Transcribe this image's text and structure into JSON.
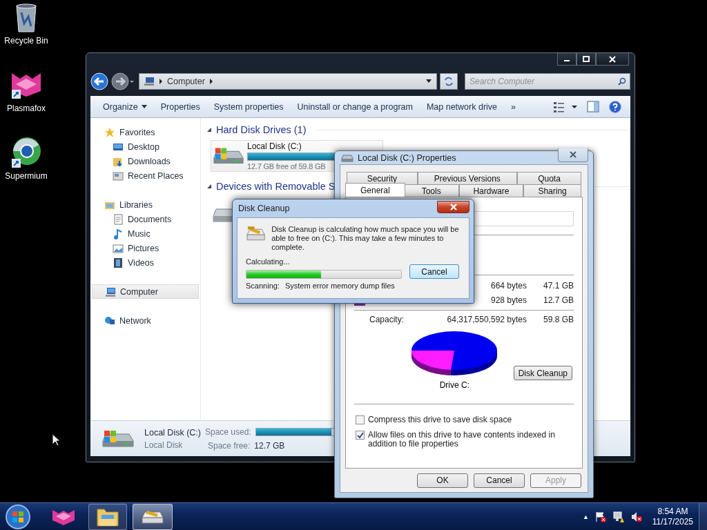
{
  "desktop_icons": [
    {
      "label": "Recycle Bin",
      "kind": "bin"
    },
    {
      "label": "Plasmafox",
      "kind": "plasmafox"
    },
    {
      "label": "Supermium",
      "kind": "supermium"
    }
  ],
  "explorer": {
    "address": "Computer",
    "search": {
      "placeholder": "Search Computer"
    },
    "toolbar": [
      {
        "label": "Organize",
        "dropdown": true
      },
      {
        "label": "Properties",
        "dropdown": false
      },
      {
        "label": "System properties",
        "dropdown": false
      },
      {
        "label": "Uninstall or change a program",
        "dropdown": false
      },
      {
        "label": "Map network drive",
        "dropdown": false
      }
    ],
    "toolbar_overflow": "»",
    "nav": [
      {
        "label": "Favorites",
        "kind": "star",
        "selected": false,
        "children": [
          {
            "label": "Desktop",
            "kind": "desktop",
            "selected": false
          },
          {
            "label": "Downloads",
            "kind": "downloads",
            "selected": false
          },
          {
            "label": "Recent Places",
            "kind": "recent",
            "selected": false
          }
        ]
      },
      {
        "label": "Libraries",
        "kind": "library",
        "selected": false,
        "children": [
          {
            "label": "Documents",
            "kind": "documents",
            "selected": false
          },
          {
            "label": "Music",
            "kind": "music",
            "selected": false
          },
          {
            "label": "Pictures",
            "kind": "pictures",
            "selected": false
          },
          {
            "label": "Videos",
            "kind": "videos",
            "selected": false
          }
        ]
      },
      {
        "label": "Computer",
        "kind": "computer",
        "selected": true
      },
      {
        "label": "Network",
        "kind": "network",
        "selected": false
      }
    ],
    "groups": [
      {
        "title": "Hard Disk Drives (1)",
        "drives": [
          {
            "kind": "disk",
            "name": "Local Disk (C:)",
            "level": 0.79,
            "free": "12.7 GB free of 59.8 GB"
          }
        ]
      },
      {
        "title": "Devices with Removable S",
        "drives": [
          {
            "kind": "removable"
          }
        ]
      }
    ],
    "details": {
      "name": "Local Disk (C:)",
      "type": "Local Disk",
      "used_label": "Space used:",
      "level": 0.79,
      "free_label": "Space free:",
      "free": "12.7 GB"
    }
  },
  "properties": {
    "title": "Local Disk (C:) Properties",
    "tab_rows": [
      [
        {
          "label": "Security",
          "selected": false
        },
        {
          "label": "Previous Versions",
          "selected": false
        },
        {
          "label": "Quota",
          "selected": false
        }
      ],
      [
        {
          "label": "General",
          "selected": true
        },
        {
          "label": "Tools",
          "selected": false
        },
        {
          "label": "Hardware",
          "selected": false
        },
        {
          "label": "Sharing",
          "selected": false
        }
      ]
    ],
    "space_rows": [
      {
        "swatch": false,
        "bytes": "664 bytes",
        "size": "47.1 GB"
      },
      {
        "swatch": true,
        "bytes": "928 bytes",
        "size": "12.7 GB"
      }
    ],
    "capacity": {
      "label": "Capacity:",
      "bytes": "64,317,550,592 bytes",
      "size": "59.8 GB"
    },
    "drive_label": "Drive C:",
    "cleanup_button": "Disk Cleanup",
    "options": [
      {
        "label": "Compress this drive to save disk space",
        "checked": false
      },
      {
        "label": "Allow files on this drive to have contents indexed in addition to file properties",
        "checked": true
      }
    ],
    "buttons": [
      {
        "label": "OK",
        "disabled": false
      },
      {
        "label": "Cancel",
        "disabled": false
      },
      {
        "label": "Apply",
        "disabled": true
      }
    ]
  },
  "cleanup": {
    "title": "Disk Cleanup",
    "message": "Disk Cleanup is calculating how much space you will be able to free on  (C:). This may take a few minutes to complete.",
    "status": "Calculating...",
    "level": 0.48,
    "cancel": "Cancel",
    "scanning_label": "Scanning:",
    "scanning_item": "System error memory dump files"
  },
  "taskbar": {
    "items": [
      {
        "kind": "plasmafox",
        "selected": false
      },
      {
        "kind": "explorer",
        "selected": false
      },
      {
        "kind": "cleanup",
        "selected": true
      }
    ],
    "tray_arrow": "▲",
    "time": "8:54 AM",
    "date": "11/17/2025"
  }
}
